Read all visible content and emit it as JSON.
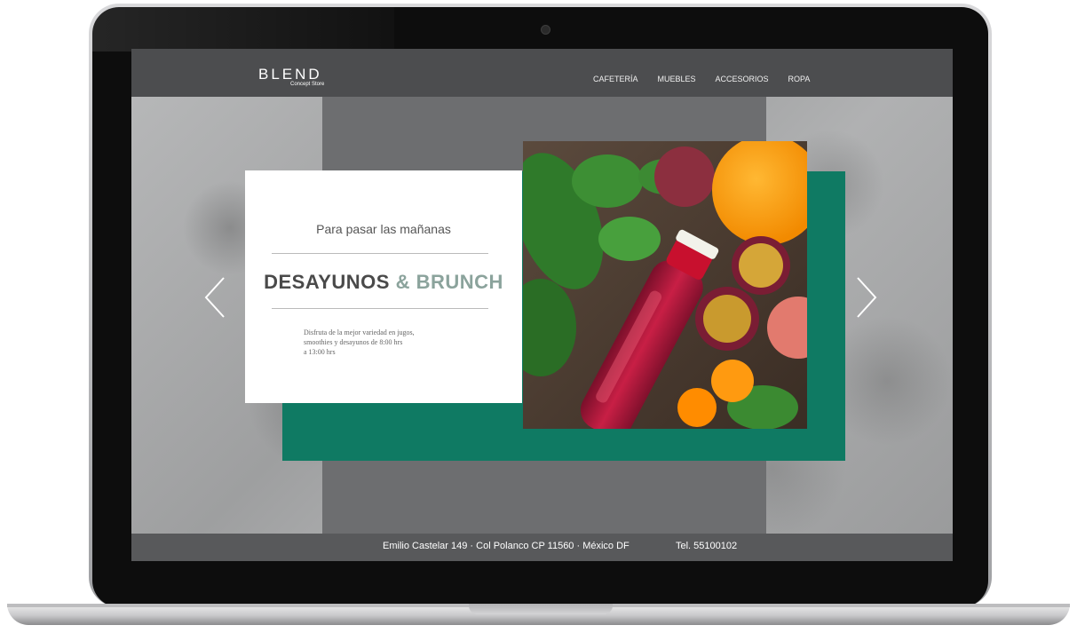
{
  "brand": {
    "name": "BLEND",
    "tagline": "Concept Store"
  },
  "nav": {
    "items": [
      "CAFETERÍA",
      "MUEBLES",
      "ACCESORIOS",
      "ROPA"
    ]
  },
  "hero": {
    "subtitle": "Para pasar las mañanas",
    "heading_main": "DESAYUNOS",
    "heading_amp": "&",
    "heading_end": "BRUNCH",
    "body": [
      "Disfruta de la mejor variedad en jugos,",
      "smoothies y desayunos de 8:00 hrs",
      " a 13:00 hrs"
    ]
  },
  "footer": {
    "address": "Emilio Castelar 149 · Col Polanco   CP 11560 · México DF",
    "phone": "Tel. 55100102"
  },
  "icons": {
    "prev": "chevron-left-icon",
    "next": "chevron-right-icon"
  },
  "colors": {
    "accent_green": "#0f7a63",
    "nav_bg": "#4c4d4f",
    "heading": "#4a4a4a",
    "amp": "#8ba39c"
  }
}
